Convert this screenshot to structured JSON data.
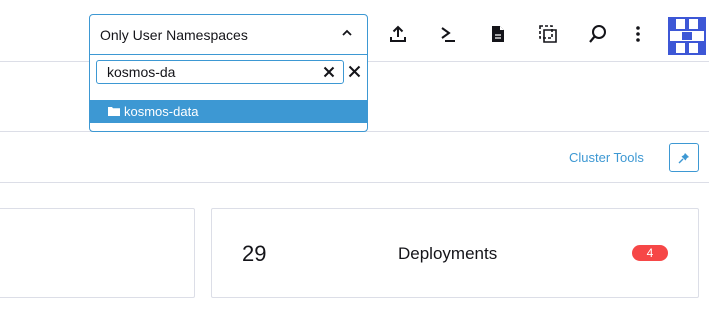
{
  "namespace_filter": {
    "selected_label": "Only User Namespaces",
    "search_value": "kosmos-da",
    "options": [
      {
        "label": "kosmos-data"
      }
    ]
  },
  "toolbar": {
    "icons": [
      "upload-icon",
      "terminal-icon",
      "file-icon",
      "copy-icon",
      "search-icon",
      "more-vertical-icon"
    ]
  },
  "cluster_tools": {
    "label": "Cluster Tools"
  },
  "cards": [
    {
      "count": "29",
      "label": "Deployments",
      "badge": "4"
    }
  ],
  "colors": {
    "accent": "#3d98d3",
    "logo": "#3d57d6",
    "error_badge": "#f64747",
    "border": "#dcdee7"
  }
}
